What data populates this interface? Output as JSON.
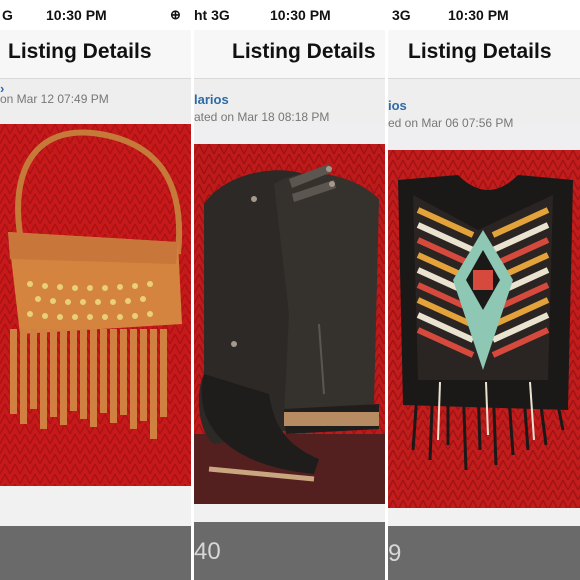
{
  "panels": [
    {
      "status": {
        "left": "G",
        "time": "10:30 PM",
        "right": "ᴇ"
      },
      "nav_title": "Listing Details",
      "user": "",
      "date": "on Mar 12 07:49 PM",
      "photo": "fringe-studded-handbag",
      "toolbar_text": ""
    },
    {
      "status": {
        "left": "ht 3G",
        "time": "10:30 PM",
        "right": ""
      },
      "nav_title": "Listing Details",
      "user": "larios",
      "date": "ated on Mar 18 08:18 PM",
      "photo": "black-leather-boots",
      "toolbar_text": "40"
    },
    {
      "status": {
        "left": "3G",
        "time": "10:30 PM",
        "right": ""
      },
      "nav_title": "Listing Details",
      "user": "ios",
      "date": "ed on Mar 06 07:56 PM",
      "photo": "aztec-fringe-top",
      "toolbar_text": "9"
    }
  ],
  "colors": {
    "link": "#2c6aa8",
    "photo_bg": "#c91b1b",
    "toolbar": "#6a6a6a"
  }
}
